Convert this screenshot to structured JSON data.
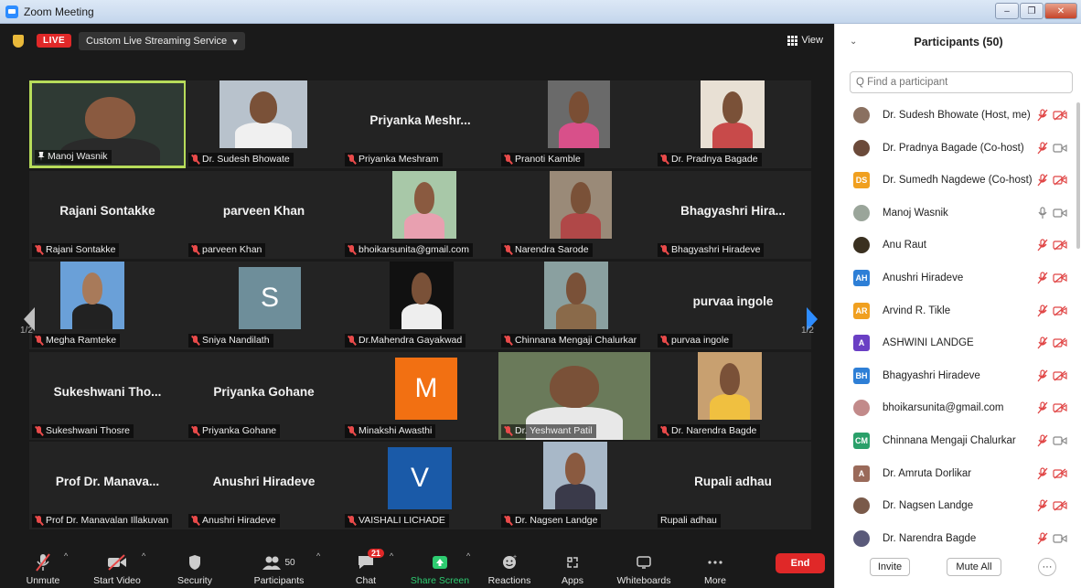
{
  "window": {
    "title": "Zoom Meeting",
    "buttons": [
      "–",
      "❐",
      "✕"
    ]
  },
  "topbar": {
    "live": "LIVE",
    "stream_service": "Custom Live Streaming Service",
    "view": "View"
  },
  "gallery": {
    "page": "1/2",
    "tiles": [
      {
        "name": "Manoj Wasnik",
        "kind": "video",
        "active": true,
        "pinned": true
      },
      {
        "name": "Dr. Sudesh Bhowate",
        "kind": "photo",
        "muted": true
      },
      {
        "name": "Priyanka Meshram",
        "big": "Priyanka  Meshr...",
        "kind": "name",
        "muted": true
      },
      {
        "name": "Pranoti Kamble",
        "kind": "photo",
        "muted": true
      },
      {
        "name": "Dr. Pradnya Bagade",
        "kind": "photo",
        "muted": true
      },
      {
        "name": "Rajani Sontakke",
        "big": "Rajani Sontakke",
        "kind": "name",
        "muted": true
      },
      {
        "name": "parveen Khan",
        "big": "parveen Khan",
        "kind": "name",
        "muted": true
      },
      {
        "name": "bhoikarsunita@gmail.com",
        "kind": "photo",
        "muted": true
      },
      {
        "name": "Narendra Sarode",
        "kind": "photo",
        "muted": true
      },
      {
        "name": "Bhagyashri Hiradeve",
        "big": "Bhagyashri  Hira...",
        "kind": "name",
        "muted": true
      },
      {
        "name": "Megha Ramteke",
        "kind": "photo",
        "muted": true
      },
      {
        "name": "Sniya Nandilath",
        "kind": "letter",
        "letter": "S",
        "muted": true
      },
      {
        "name": "Dr.Mahendra Gayakwad",
        "kind": "photo",
        "muted": true
      },
      {
        "name": "Chinnana Mengaji Chalurkar",
        "kind": "photo",
        "muted": true
      },
      {
        "name": "purvaa ingole",
        "big": "purvaa ingole",
        "kind": "name",
        "muted": true
      },
      {
        "name": "Sukeshwani Thosre",
        "big": "Sukeshwani  Tho...",
        "kind": "name",
        "muted": true
      },
      {
        "name": "Priyanka Gohane",
        "big": "Priyanka Gohane",
        "kind": "name",
        "muted": true
      },
      {
        "name": "Minakshi Awasthi",
        "kind": "letter",
        "letter": "M",
        "muted": true
      },
      {
        "name": "Dr. Yeshwant Patil",
        "kind": "video",
        "muted": true
      },
      {
        "name": "Dr. Narendra Bagde",
        "kind": "photo",
        "muted": true
      },
      {
        "name": "Prof Dr. Manavalan Illakuvan",
        "big": "Prof Dr. Manava...",
        "kind": "name",
        "muted": true
      },
      {
        "name": "Anushri Hiradeve",
        "big": "Anushri Hiradeve",
        "kind": "name",
        "muted": true
      },
      {
        "name": "VAISHALI LICHADE",
        "kind": "letter",
        "letter": "V",
        "muted": true
      },
      {
        "name": "Dr. Nagsen Landge",
        "kind": "photo",
        "muted": true
      },
      {
        "name": "Rupali adhau",
        "big": "Rupali adhau",
        "kind": "name",
        "muted": false
      }
    ]
  },
  "toolbar": {
    "unmute": "Unmute",
    "start_video": "Start Video",
    "security": "Security",
    "participants": "Participants",
    "participants_count": "50",
    "chat": "Chat",
    "chat_badge": "21",
    "share_screen": "Share Screen",
    "reactions": "Reactions",
    "apps": "Apps",
    "whiteboards": "Whiteboards",
    "more": "More",
    "end": "End"
  },
  "panel": {
    "title": "Participants (50)",
    "search_placeholder": "Q Find a participant",
    "participants": [
      {
        "name": "Dr. Sudesh Bhowate (Host, me)",
        "initials": "",
        "color": "#8a7060",
        "mic": "off",
        "video": "off"
      },
      {
        "name": "Dr. Pradnya Bagade (Co-host)",
        "initials": "",
        "color": "#6b4a3a",
        "mic": "off",
        "video": "on"
      },
      {
        "name": "Dr. Sumedh Nagdewe (Co-host)",
        "initials": "DS",
        "color": "#f0a020",
        "mic": "off",
        "video": "off"
      },
      {
        "name": "Manoj Wasnik",
        "initials": "",
        "color": "#9aa59a",
        "mic": "on",
        "video": "on"
      },
      {
        "name": "Anu Raut",
        "initials": "",
        "color": "#3a3020",
        "mic": "off",
        "video": "off"
      },
      {
        "name": "Anushri Hiradeve",
        "initials": "AH",
        "color": "#2e7fd6",
        "mic": "off",
        "video": "off"
      },
      {
        "name": "Arvind R. Tikle",
        "initials": "AR",
        "color": "#f0a020",
        "mic": "off",
        "video": "off"
      },
      {
        "name": "ASHWINI LANDGE",
        "initials": "A",
        "color": "#6a3fc4",
        "mic": "off",
        "video": "off"
      },
      {
        "name": "Bhagyashri Hiradeve",
        "initials": "BH",
        "color": "#2e7fd6",
        "mic": "off",
        "video": "off"
      },
      {
        "name": "bhoikarsunita@gmail.com",
        "initials": "",
        "color": "#c28a8a",
        "mic": "off",
        "video": "off"
      },
      {
        "name": "Chinnana Mengaji Chalurkar",
        "initials": "CM",
        "color": "#2aa06a",
        "mic": "off",
        "video": "on"
      },
      {
        "name": "Dr. Amruta Dorlikar",
        "initials": "A",
        "color": "#9a6a5a",
        "mic": "off",
        "video": "off"
      },
      {
        "name": "Dr. Nagsen Landge",
        "initials": "",
        "color": "#7a5a4a",
        "mic": "off",
        "video": "off"
      },
      {
        "name": "Dr. Narendra Bagde",
        "initials": "",
        "color": "#5a5a7a",
        "mic": "off",
        "video": "on"
      }
    ],
    "invite": "Invite",
    "mute_all": "Mute All",
    "more": "···"
  }
}
